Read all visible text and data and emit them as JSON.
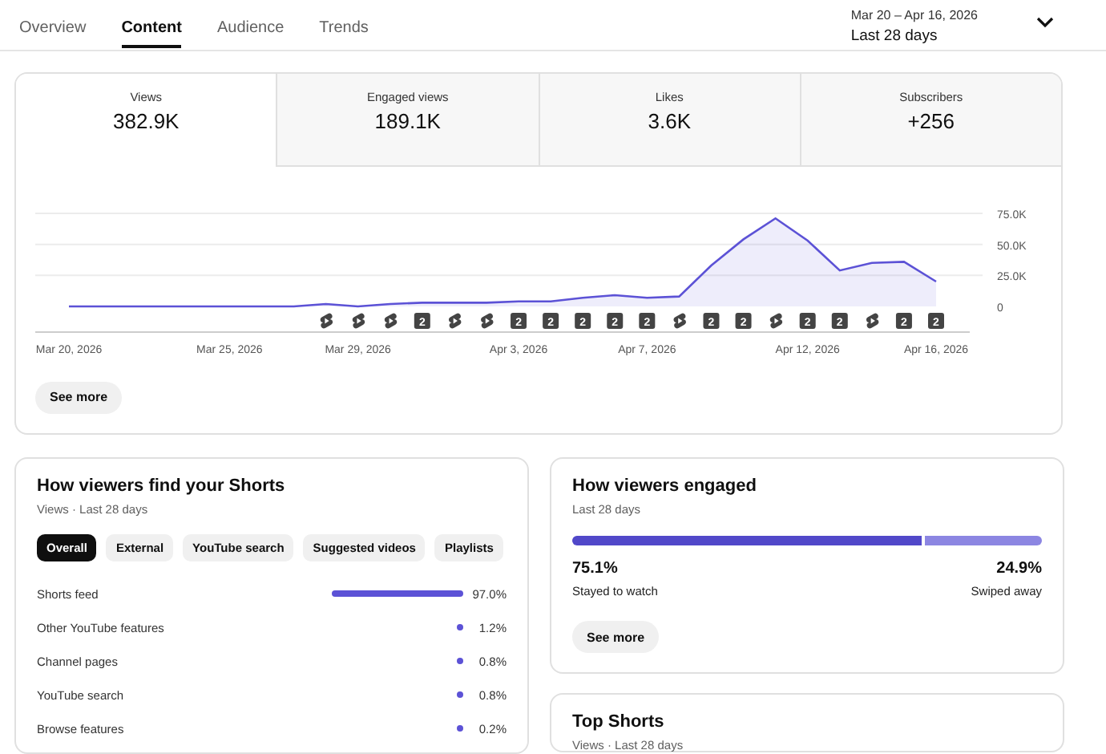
{
  "nav": {
    "tabs": [
      {
        "label": "Overview",
        "selected": false
      },
      {
        "label": "Content",
        "selected": true
      },
      {
        "label": "Audience",
        "selected": false
      },
      {
        "label": "Trends",
        "selected": false
      }
    ]
  },
  "date_range": {
    "range": "Mar 20 – Apr 16, 2026",
    "label": "Last 28 days"
  },
  "metrics": [
    {
      "label": "Views",
      "value": "382.9K",
      "selected": true
    },
    {
      "label": "Engaged views",
      "value": "189.1K",
      "selected": false
    },
    {
      "label": "Likes",
      "value": "3.6K",
      "selected": false
    },
    {
      "label": "Subscribers",
      "value": "+256",
      "selected": false
    }
  ],
  "chart": {
    "chart_data": {
      "type": "area",
      "categories": [
        "Mar 20, 2026",
        null,
        null,
        null,
        null,
        "Mar 25, 2026",
        null,
        null,
        null,
        "Mar 29, 2026",
        null,
        null,
        null,
        null,
        "Apr 3, 2026",
        null,
        null,
        null,
        "Apr 7, 2026",
        null,
        null,
        null,
        null,
        "Apr 12, 2026",
        null,
        null,
        null,
        "Apr 16, 2026"
      ],
      "series": [
        {
          "color": "#5c52d6",
          "values": [
            0,
            0,
            0,
            0,
            0,
            0,
            0,
            0,
            2000,
            0,
            2000,
            3000,
            3000,
            3000,
            4000,
            4000,
            7000,
            9000,
            7000,
            8000,
            33000,
            54000,
            71000,
            53000,
            29000,
            35000,
            36000,
            20000
          ]
        }
      ],
      "ylim": [
        0,
        75000
      ],
      "yticks": [
        {
          "value": 0,
          "label": "0"
        },
        {
          "value": 25000,
          "label": "25.0K"
        },
        {
          "value": 50000,
          "label": "50.0K"
        },
        {
          "value": 75000,
          "label": "75.0K"
        }
      ]
    },
    "markers": [
      {
        "kind": "none"
      },
      {
        "kind": "none"
      },
      {
        "kind": "none"
      },
      {
        "kind": "none"
      },
      {
        "kind": "none"
      },
      {
        "kind": "none"
      },
      {
        "kind": "none"
      },
      {
        "kind": "none"
      },
      {
        "kind": "shorts"
      },
      {
        "kind": "shorts"
      },
      {
        "kind": "shorts"
      },
      {
        "kind": "count",
        "label": "2"
      },
      {
        "kind": "shorts"
      },
      {
        "kind": "shorts"
      },
      {
        "kind": "count",
        "label": "2"
      },
      {
        "kind": "count",
        "label": "2"
      },
      {
        "kind": "count",
        "label": "2"
      },
      {
        "kind": "count",
        "label": "2"
      },
      {
        "kind": "count",
        "label": "2"
      },
      {
        "kind": "shorts"
      },
      {
        "kind": "count",
        "label": "2"
      },
      {
        "kind": "count",
        "label": "2"
      },
      {
        "kind": "shorts"
      },
      {
        "kind": "count",
        "label": "2"
      },
      {
        "kind": "count",
        "label": "2"
      },
      {
        "kind": "shorts"
      },
      {
        "kind": "count",
        "label": "2"
      },
      {
        "kind": "count",
        "label": "2"
      }
    ],
    "button": "See more"
  },
  "traffic": {
    "title": "How viewers find your Shorts",
    "subtitle": "Views · Last 28 days",
    "filters": [
      {
        "label": "Overall",
        "selected": true
      },
      {
        "label": "External",
        "selected": false
      },
      {
        "label": "YouTube search",
        "selected": false
      },
      {
        "label": "Suggested videos",
        "selected": false
      },
      {
        "label": "Playlists",
        "selected": false
      }
    ],
    "sources": [
      {
        "name": "Shorts feed",
        "value": "97.0%"
      },
      {
        "name": "Other YouTube features",
        "value": "1.2%"
      },
      {
        "name": "Channel pages",
        "value": "0.8%"
      },
      {
        "name": "YouTube search",
        "value": "0.8%"
      },
      {
        "name": "Browse features",
        "value": "0.2%"
      }
    ]
  },
  "engaged": {
    "title": "How viewers engaged",
    "subtitle": "Last 28 days",
    "level": 0.751,
    "stayed": {
      "value": "75.1%",
      "label": "Stayed to watch"
    },
    "swiped": {
      "value": "24.9%",
      "label": "Swiped away"
    },
    "button": "See more"
  },
  "top_shorts": {
    "title": "Top Shorts",
    "subtitle": "Views · Last 28 days"
  }
}
